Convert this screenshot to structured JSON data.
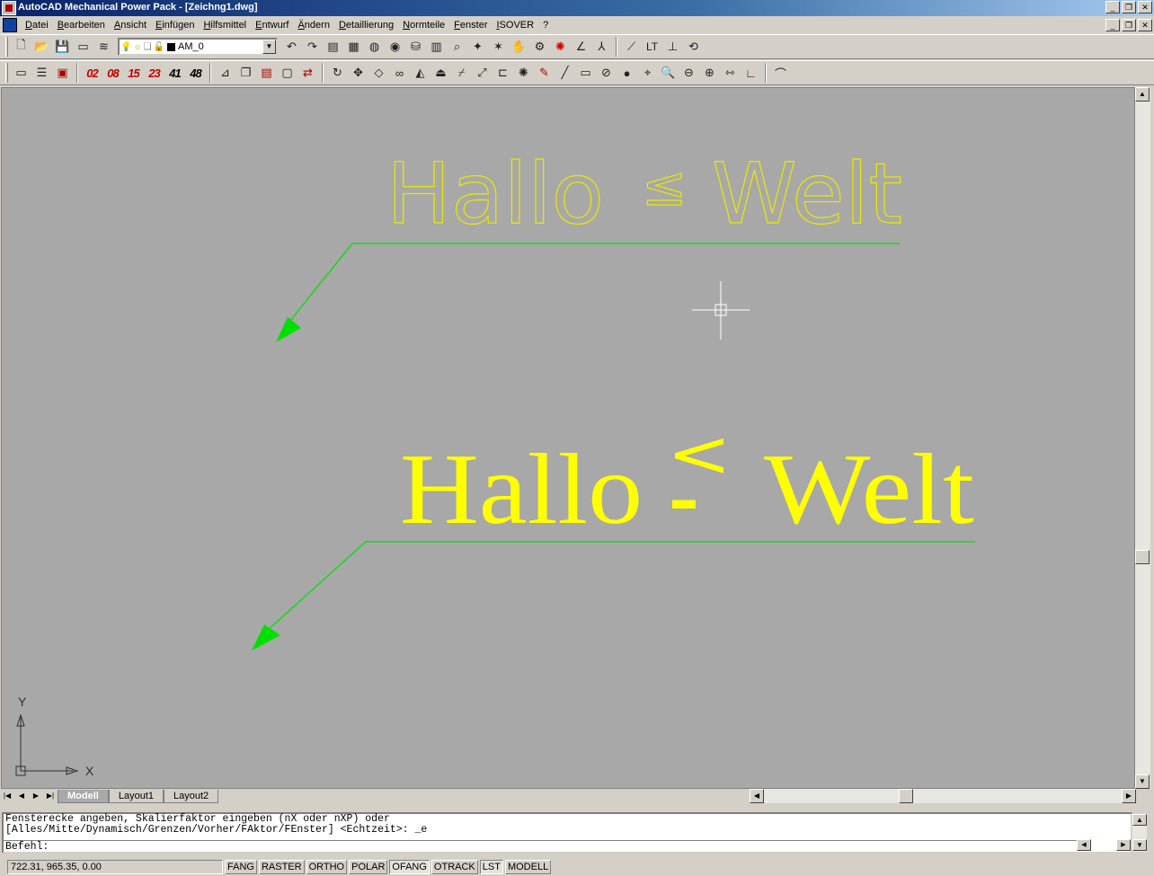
{
  "window": {
    "title": "AutoCAD Mechanical Power Pack - [Zeichng1.dwg]",
    "minimize": "_",
    "restore": "❐",
    "close": "✕"
  },
  "menu": {
    "items": [
      "Datei",
      "Bearbeiten",
      "Ansicht",
      "Einfügen",
      "Hilfsmittel",
      "Entwurf",
      "Ändern",
      "Detaillierung",
      "Normteile",
      "Fenster",
      "ISOVER",
      "?"
    ]
  },
  "toolbar": {
    "layer_name": "AM_0",
    "scale_buttons": [
      "02",
      "08",
      "15",
      "23",
      "41",
      "48"
    ],
    "lt_label": "LT"
  },
  "drawing": {
    "text1_left": "Hallo",
    "text1_sym": "≤",
    "text1_right": "Welt",
    "text2_left": "Hallo",
    "text2_sym": "<",
    "text2_dash": "-",
    "text2_right": "Welt",
    "ucs_y": "Y",
    "ucs_x": "X",
    "colors": {
      "background": "#a8a8a8",
      "text_simplex": "#e8e800",
      "text_serif": "#ffff00",
      "leader": "#00e000",
      "crosshair": "#ffffff",
      "ucs": "#303030"
    }
  },
  "tabs": [
    "Modell",
    "Layout1",
    "Layout2"
  ],
  "command": {
    "line1": "Fensterecke angeben, Skalierfaktor eingeben (nX oder nXP) oder",
    "line2": "[Alles/Mitte/Dynamisch/Grenzen/Vorher/FAktor/FEnster] <Echtzeit>: _e",
    "prompt": "Befehl:"
  },
  "status": {
    "coordinates": "722.31, 965.35, 0.00",
    "toggles": [
      {
        "label": "FANG",
        "on": false
      },
      {
        "label": "RASTER",
        "on": false
      },
      {
        "label": "ORTHO",
        "on": false
      },
      {
        "label": "POLAR",
        "on": false
      },
      {
        "label": "OFANG",
        "on": true
      },
      {
        "label": "OTRACK",
        "on": false
      },
      {
        "label": "LST",
        "on": true
      },
      {
        "label": "MODELL",
        "on": false
      }
    ]
  }
}
